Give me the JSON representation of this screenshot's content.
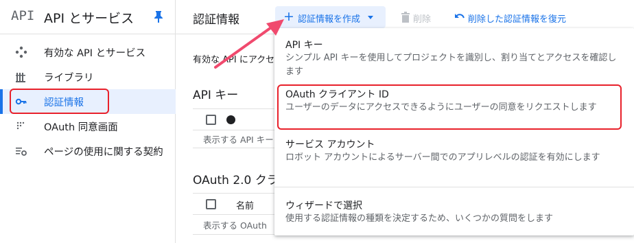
{
  "sidebar": {
    "logo": "API",
    "title": "API とサービス",
    "items": [
      {
        "label": "有効な API とサービス",
        "icon": "diamond-dots-icon"
      },
      {
        "label": "ライブラリ",
        "icon": "library-icon"
      },
      {
        "label": "認証情報",
        "icon": "key-icon",
        "active": true
      },
      {
        "label": "OAuth 同意画面",
        "icon": "consent-dots-icon"
      },
      {
        "label": "ページの使用に関する契約",
        "icon": "settings-list-icon"
      }
    ]
  },
  "header": {
    "title": "認証情報",
    "create_label": "認証情報を作成",
    "delete_label": "削除",
    "restore_label": "削除した認証情報を復元"
  },
  "main": {
    "description": "有効な API にアクセ",
    "api_keys_title": "API キー",
    "api_keys_empty": "表示する API キー",
    "oauth_title": "OAuth 2.0 クラ",
    "oauth_col_name": "名前",
    "oauth_empty": "表示する OAuth"
  },
  "menu": {
    "items": [
      {
        "title": "API キー",
        "desc": "シンプル API キーを使用してプロジェクトを識別し、割り当てとアクセスを確認します"
      },
      {
        "title": "OAuth クライアント ID",
        "desc": "ユーザーのデータにアクセスできるようにユーザーの同意をリクエストします"
      },
      {
        "title": "サービス アカウント",
        "desc": "ロボット アカウントによるサーバー間でのアプリレベルの認証を有効にします"
      },
      {
        "title": "ウィザードで選択",
        "desc": "使用する認証情報の種類を決定するため、いくつかの質問をします"
      }
    ]
  },
  "colors": {
    "accent": "#1a73e8",
    "active_bg": "#e8f0fe",
    "highlight": "#e8202a",
    "arrow": "#f04a6e"
  }
}
